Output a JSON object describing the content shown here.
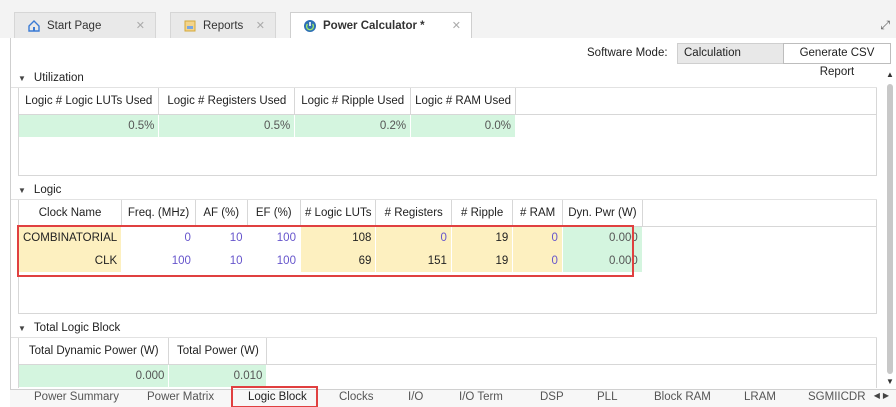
{
  "doc_tabs": [
    {
      "label": "Start Page",
      "icon": "home-icon"
    },
    {
      "label": "Reports",
      "icon": "report-icon"
    },
    {
      "label": "Power Calculator *",
      "icon": "power-calculator-icon",
      "active": true
    }
  ],
  "toolbar": {
    "mode_label": "Software Mode:",
    "mode_value": "Calculation",
    "csv_button": "Generate CSV Report"
  },
  "utilization": {
    "title": "Utilization",
    "headers": [
      "Logic # Logic LUTs Used",
      "Logic # Registers Used",
      "Logic # Ripple Used",
      "Logic # RAM Used"
    ],
    "values": [
      "0.5%",
      "0.5%",
      "0.2%",
      "0.0%"
    ]
  },
  "logic": {
    "title": "Logic",
    "headers": [
      "Clock Name",
      "Freq. (MHz)",
      "AF (%)",
      "EF (%)",
      "# Logic LUTs",
      "# Registers",
      "# Ripple",
      "# RAM",
      "Dyn. Pwr (W)"
    ],
    "rows": [
      [
        "COMBINATORIAL",
        "0",
        "10",
        "100",
        "108",
        "0",
        "19",
        "0",
        "0.000"
      ],
      [
        "CLK",
        "100",
        "10",
        "100",
        "69",
        "151",
        "19",
        "0",
        "0.000"
      ]
    ]
  },
  "total": {
    "title": "Total Logic Block",
    "headers": [
      "Total Dynamic Power (W)",
      "Total Power (W)"
    ],
    "values": [
      "0.000",
      "0.010"
    ]
  },
  "bottom_tabs": [
    "Power Summary",
    "Power Matrix",
    "Logic Block",
    "Clocks",
    "I/O",
    "I/O Term",
    "DSP",
    "PLL",
    "Block RAM",
    "LRAM",
    "SGMIICDR"
  ],
  "active_bottom_tab": "Logic Block",
  "colors": {
    "highlight": "#e04040",
    "green_cell": "#d4f5df",
    "yellow_cell": "#fdf0c0",
    "purple_text": "#6655cc"
  }
}
